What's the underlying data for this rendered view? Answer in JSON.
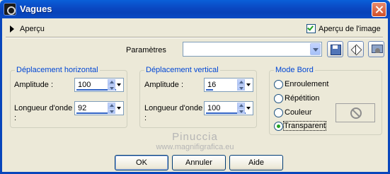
{
  "window": {
    "title": "Vagues"
  },
  "preview": {
    "toggle_label": "Aperçu",
    "checkbox_label": "Aperçu de l'image",
    "checked": true
  },
  "params": {
    "label": "Paramètres",
    "value": ""
  },
  "horizontal": {
    "title": "Déplacement horizontal",
    "amplitude_label": "Amplitude :",
    "amplitude_value": "100",
    "wavelength_label": "Longueur d'onde :",
    "wavelength_value": "92"
  },
  "vertical": {
    "title": "Déplacement vertical",
    "amplitude_label": "Amplitude :",
    "amplitude_value": "16",
    "wavelength_label": "Longueur d'onde :",
    "wavelength_value": "100"
  },
  "edge_mode": {
    "title": "Mode Bord",
    "options": [
      "Enroulement",
      "Répétition",
      "Couleur",
      "Transparent"
    ],
    "selected": "Transparent"
  },
  "watermark": {
    "line1": "Pinuccia",
    "line2": "www.magnifigrafica.eu"
  },
  "buttons": {
    "ok": "OK",
    "cancel": "Annuler",
    "help": "Aide"
  },
  "colors": {
    "titlebar": "#0a48c2",
    "group_title": "#0046d5",
    "dialog_bg": "#ece9d8"
  }
}
